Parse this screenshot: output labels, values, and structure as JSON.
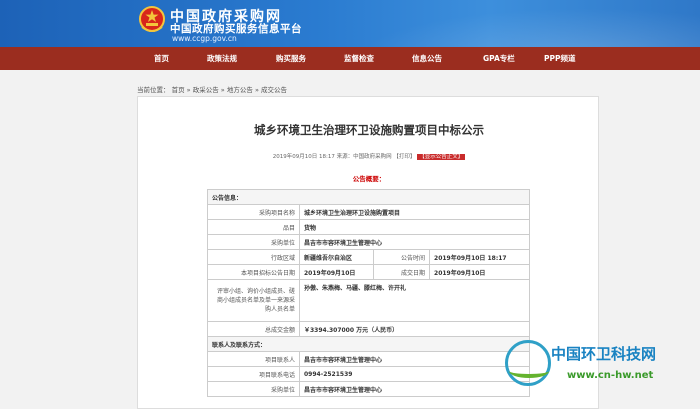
{
  "header": {
    "site_name": "中国政府采购网",
    "subtitle": "中国政府购买服务信息平台",
    "url": "www.ccgp.gov.cn"
  },
  "nav": {
    "items": [
      "首页",
      "政策法规",
      "购买服务",
      "监督检查",
      "信息公告",
      "GPA专栏",
      "PPP频道"
    ]
  },
  "breadcrumb": {
    "prefix": "当前位置：",
    "items": [
      "首页",
      "政采公告",
      "地方公告",
      "成交公告"
    ],
    "separator": "»"
  },
  "article": {
    "title": "城乡环境卫生治理环卫设施购置项目中标公示",
    "date": "2019年09月10日 18:17",
    "source_label": "来源：",
    "source": "中国政府采购网",
    "print": "【打印】",
    "show_original": "【显示公告正文】",
    "summary_heading": "公告概要："
  },
  "table": {
    "section_info": "公告信息：",
    "project_name_label": "采购项目名称",
    "project_name": "城乡环境卫生治理环卫设施购置项目",
    "item_label": "品目",
    "item": "货物",
    "buyer_label": "采购单位",
    "buyer": "昌吉市市容环境卫生管理中心",
    "region_label": "行政区域",
    "region": "新疆维吾尔自治区",
    "notice_time_label": "公告时间",
    "notice_time": "2019年09月10日  18:17",
    "bid_notice_date_label": "本项目招标公告日期",
    "bid_notice_date": "2019年09月10日",
    "award_date_label": "成交日期",
    "award_date": "2019年09月10日",
    "panel_label": "评审小组、询价小组成员、磋商小组成员名单及单一来源采购人员名单",
    "panel_members": "孙傲、朱燕梅、马疆、滕红梅、许开礼",
    "total_label": "总成交金额",
    "total": "￥3394.307000 万元（人民币）",
    "section_contact": "联系人及联系方式：",
    "contact_label": "项目联系人",
    "contact": "昌吉市市容环境卫生管理中心",
    "phone_label": "项目联系电话",
    "phone": "0994-2521539",
    "buyer2_label": "采购单位",
    "buyer2": "昌吉市市容环境卫生管理中心"
  },
  "watermark": {
    "name": "中国环卫科技网",
    "url": "www.cn-hw.net"
  }
}
